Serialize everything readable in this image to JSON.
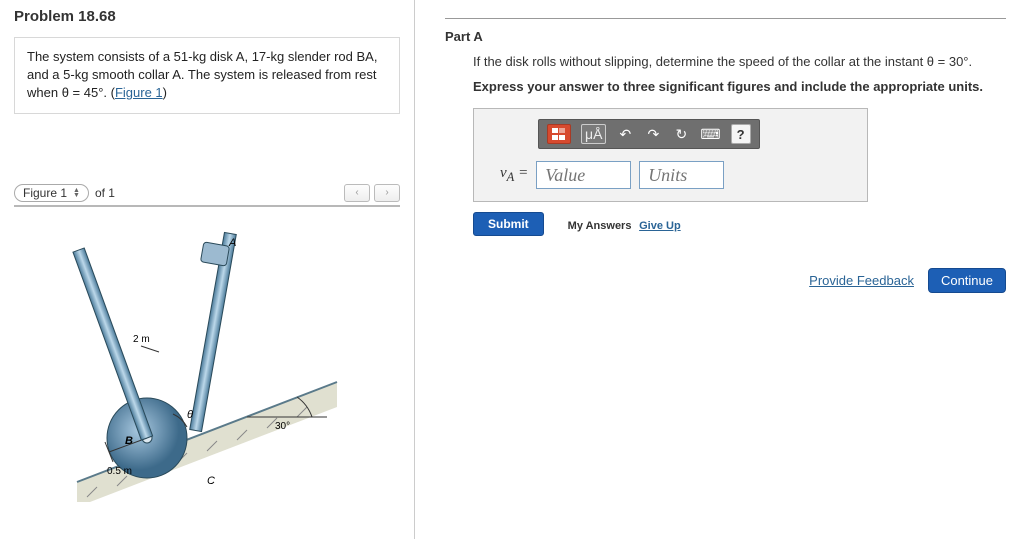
{
  "problem": {
    "title": "Problem 18.68",
    "statement_html": "The system consists of a 51-kg disk A, 17-kg slender rod BA, and a 5-kg smooth collar A. The system is released from rest when θ = 45°. (",
    "figure_link": "Figure 1",
    "statement_tail": ")"
  },
  "figure": {
    "selector_label": "Figure 1",
    "count_label": "of 1",
    "rod_len": "2 m",
    "disk_radius": "0.5 m",
    "disk_label": "B",
    "angle": "30°",
    "top_label": "A",
    "ground_label": "C",
    "theta_label": "θ"
  },
  "partA": {
    "label": "Part A",
    "prompt": "If the disk rolls without slipping, determine the speed of the collar at the instant θ = 30°.",
    "instruction": "Express your answer to three significant figures and include the appropriate units.",
    "var_label": "v_A =",
    "value_placeholder": "Value",
    "units_placeholder": "Units",
    "toolbar": {
      "templates": "templates-icon",
      "symbols": "μÅ",
      "undo": "↶",
      "redo": "↷",
      "reset": "↻",
      "keyboard": "⌨",
      "help": "?"
    },
    "submit": "Submit",
    "my_answers": "My Answers",
    "give_up": "Give Up"
  },
  "footer": {
    "feedback": "Provide Feedback",
    "continue": "Continue"
  }
}
